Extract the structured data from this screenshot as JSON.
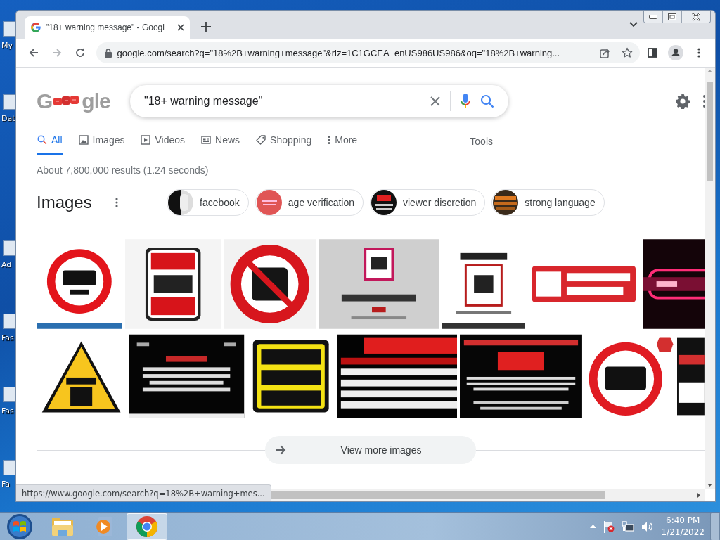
{
  "desktop": {
    "icon_labels": [
      "My",
      "Dat",
      "Ad",
      "Fas",
      "Fas",
      "Fa"
    ]
  },
  "browser": {
    "tab_title": "\"18+ warning message\" - Googl",
    "nav_buttons": [
      {
        "kind": "back",
        "disabled": false
      },
      {
        "kind": "forward",
        "disabled": true
      },
      {
        "kind": "reload",
        "disabled": false
      }
    ],
    "address": "google.com/search?q=\"18%2B+warning+message\"&rlz=1C1GCEA_enUS986US986&oq=\"18%2B+warning..."
  },
  "page": {
    "logo": [
      "G",
      "gle"
    ],
    "search": {
      "value": "\"18+ warning message\""
    },
    "nav_tabs": [
      {
        "label": "All",
        "kind": "all",
        "selected": true
      },
      {
        "label": "Images",
        "kind": "images",
        "selected": false
      },
      {
        "label": "Videos",
        "kind": "videos",
        "selected": false
      },
      {
        "label": "News",
        "kind": "news",
        "selected": false
      },
      {
        "label": "Shopping",
        "kind": "shopping",
        "selected": false
      },
      {
        "label": "More",
        "kind": "more",
        "selected": false
      }
    ],
    "tools": "Tools",
    "result_stats": "About 7,800,000 results (1.24 seconds)",
    "images_heading": "Images",
    "chips": [
      {
        "label": "facebook"
      },
      {
        "label": "age verification"
      },
      {
        "label": "viewer discretion"
      },
      {
        "label": "strong language"
      }
    ],
    "image_rows": [
      [
        {
          "kind": "picture"
        },
        {
          "kind": "picture"
        },
        {
          "kind": "picture"
        },
        {
          "kind": "picture"
        },
        {
          "kind": "picture"
        },
        {
          "kind": "picture"
        },
        {
          "kind": "picture"
        }
      ],
      [
        {
          "kind": "picture"
        },
        {
          "kind": "picture"
        },
        {
          "kind": "picture"
        },
        {
          "kind": "picture"
        },
        {
          "kind": "picture"
        },
        {
          "kind": "picture"
        },
        {
          "kind": "picture"
        }
      ]
    ],
    "view_more": "View more images"
  },
  "status_url": "https://www.google.com/search?q=18%2B+warning+mes...",
  "taskbar": {
    "apps": [
      {
        "kind": "explorer",
        "selected": false
      },
      {
        "kind": "media",
        "selected": false
      },
      {
        "kind": "chrome",
        "selected": true
      }
    ],
    "time": "6:40 PM",
    "date": "1/21/2022"
  }
}
